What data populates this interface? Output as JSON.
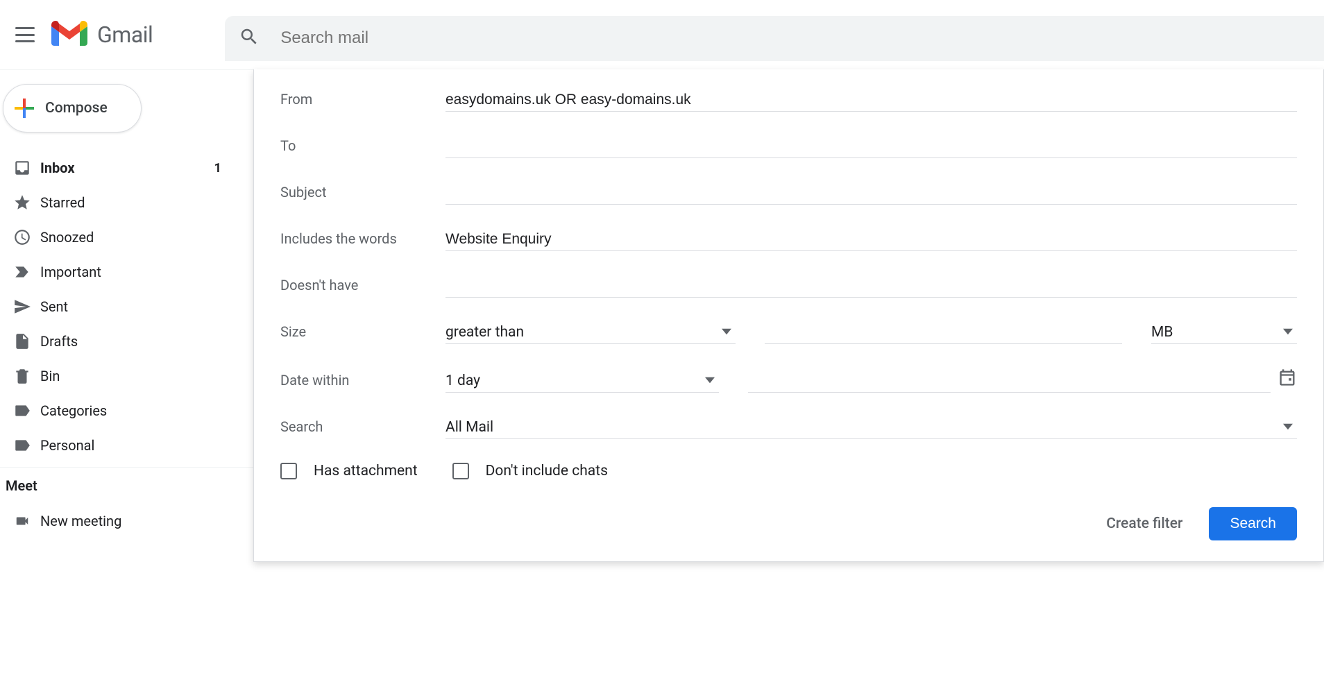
{
  "header": {
    "product_name": "Gmail",
    "search_placeholder": "Search mail"
  },
  "sidebar": {
    "compose_label": "Compose",
    "items": [
      {
        "label": "Inbox",
        "icon": "inbox",
        "count": "1",
        "active": true
      },
      {
        "label": "Starred",
        "icon": "star",
        "count": "",
        "active": false
      },
      {
        "label": "Snoozed",
        "icon": "clock",
        "count": "",
        "active": false
      },
      {
        "label": "Important",
        "icon": "important",
        "count": "",
        "active": false
      },
      {
        "label": "Sent",
        "icon": "send",
        "count": "",
        "active": false
      },
      {
        "label": "Drafts",
        "icon": "draft",
        "count": "",
        "active": false
      },
      {
        "label": "Bin",
        "icon": "bin",
        "count": "",
        "active": false
      },
      {
        "label": "Categories",
        "icon": "label",
        "count": "",
        "active": false
      },
      {
        "label": "Personal",
        "icon": "label",
        "count": "",
        "active": false
      }
    ],
    "meet": {
      "title": "Meet",
      "items": [
        {
          "label": "New meeting",
          "icon": "video"
        }
      ]
    }
  },
  "filter": {
    "labels": {
      "from": "From",
      "to": "To",
      "subject": "Subject",
      "includes": "Includes the words",
      "doesnt_have": "Doesn't have",
      "size": "Size",
      "date_within": "Date within",
      "search": "Search",
      "has_attachment": "Has attachment",
      "dont_include_chats": "Don't include chats",
      "create_filter": "Create filter",
      "search_button": "Search"
    },
    "values": {
      "from": "easydomains.uk OR easy-domains.uk",
      "to": "",
      "subject": "",
      "includes": "Website Enquiry",
      "doesnt_have": "",
      "size_operator": "greater than",
      "size_value": "",
      "size_unit": "MB",
      "date_range": "1 day",
      "date_value": "",
      "search_scope": "All Mail",
      "has_attachment": false,
      "dont_include_chats": false
    }
  }
}
